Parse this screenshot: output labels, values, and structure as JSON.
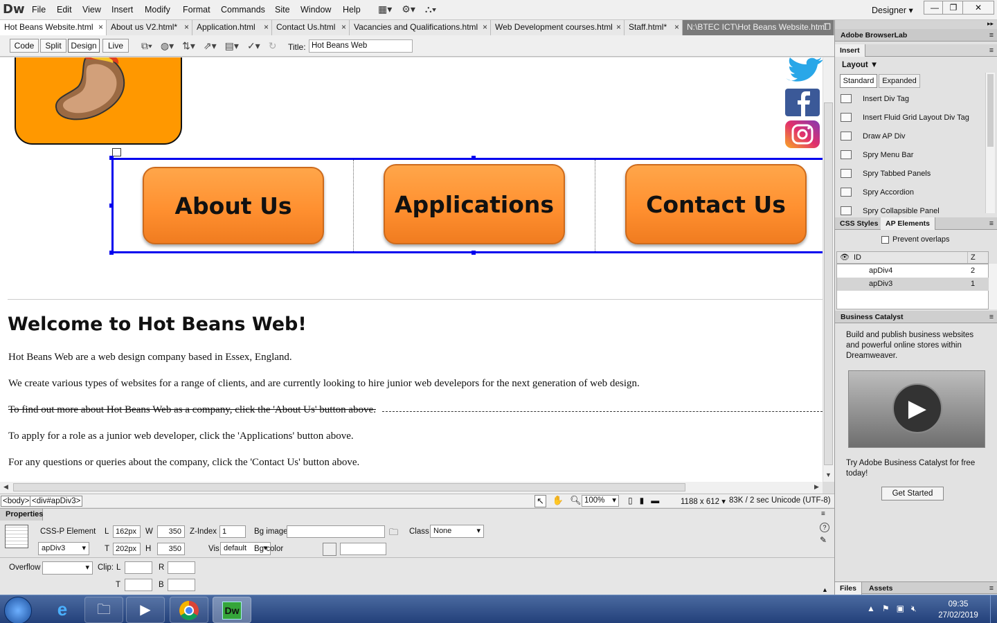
{
  "app": {
    "logo": "Dw",
    "workspace": "Designer"
  },
  "menu": [
    "File",
    "Edit",
    "View",
    "Insert",
    "Modify",
    "Format",
    "Commands",
    "Site",
    "Window",
    "Help"
  ],
  "window_controls": {
    "minimize": "—",
    "restore": "❐",
    "close": "✕"
  },
  "tabs": [
    {
      "label": "Hot Beans Website.html"
    },
    {
      "label": "About us V2.html*"
    },
    {
      "label": "Application.html"
    },
    {
      "label": "Contact Us.html"
    },
    {
      "label": "Vacancies and Qualifications.html"
    },
    {
      "label": "Web Development courses.html"
    },
    {
      "label": "Staff.html*"
    }
  ],
  "file_path": "N:\\BTEC ICT\\Hot Beans Website.html",
  "doc_toolbar": {
    "code": "Code",
    "split": "Split",
    "design": "Design",
    "live": "Live",
    "title_label": "Title:",
    "title_value": "Hot Beans Web"
  },
  "page": {
    "nav_buttons": [
      "About Us",
      "Applications",
      "Contact Us"
    ],
    "heading": "Welcome to Hot Beans Web!",
    "paragraphs": [
      "Hot Beans Web are a web design company based in Essex, England.",
      "We create various types of websites for a range of clients, and are currently looking to hire junior web develepors for the next generation of web design.",
      "To find out more about Hot Beans Web as a company, click the 'About Us' button above.",
      "To apply for a role as a junior web developer, click the 'Applications' button above.",
      "For any questions or queries about the company, click the 'Contact Us' button above."
    ],
    "social_icons": [
      "twitter-icon",
      "facebook-icon",
      "instagram-icon"
    ]
  },
  "status_bar": {
    "tag_body": "<body>",
    "tag_div": "<div#apDiv3>",
    "zoom": "100%",
    "dimensions": "1188 x 612",
    "size": "83K / 2 sec",
    "encoding": "Unicode (UTF-8)"
  },
  "properties": {
    "title": "Properties",
    "element_type": "CSS-P Element",
    "element_id": "apDiv3",
    "L_label": "L",
    "L": "162px",
    "T_label": "T",
    "T": "202px",
    "W_label": "W",
    "W": "350",
    "H_label": "H",
    "H": "350",
    "zindex_label": "Z-Index",
    "zindex": "1",
    "vis_label": "Vis",
    "vis": "default",
    "bgimage_label": "Bg image",
    "bgimage": "",
    "bgcolor_label": "Bg color",
    "bgcolor": "",
    "class_label": "Class",
    "class": "None",
    "overflow_label": "Overflow",
    "overflow": "",
    "clip_label": "Clip:",
    "clip_L": "L",
    "clip_R": "R",
    "clip_T": "T",
    "clip_B": "B"
  },
  "right_panel": {
    "browserlab": "Adobe BrowserLab",
    "insert": "Insert",
    "layout": "Layout",
    "standard": "Standard",
    "expanded": "Expanded",
    "insert_items": [
      "Insert Div Tag",
      "Insert Fluid Grid Layout Div Tag",
      "Draw AP Div",
      "Spry Menu Bar",
      "Spry Tabbed Panels",
      "Spry Accordion",
      "Spry Collapsible Panel"
    ],
    "css_styles": "CSS Styles",
    "ap_elements": "AP Elements",
    "prevent_overlaps": "Prevent overlaps",
    "ap_headers": {
      "id": "ID",
      "z": "Z"
    },
    "ap_rows": [
      {
        "id": "apDiv4",
        "z": "2"
      },
      {
        "id": "apDiv3",
        "z": "1"
      }
    ],
    "business_catalyst": "Business Catalyst",
    "bc_text": "Build and publish business websites and powerful online stores within Dreamweaver.",
    "bc_try": "Try Adobe Business Catalyst for free today!",
    "get_started": "Get Started",
    "files": "Files",
    "assets": "Assets"
  },
  "taskbar": {
    "time": "09:35",
    "date": "27/02/2019",
    "apps": [
      "ie-icon",
      "explorer-icon",
      "media-player-icon",
      "chrome-icon",
      "dreamweaver-icon"
    ]
  }
}
